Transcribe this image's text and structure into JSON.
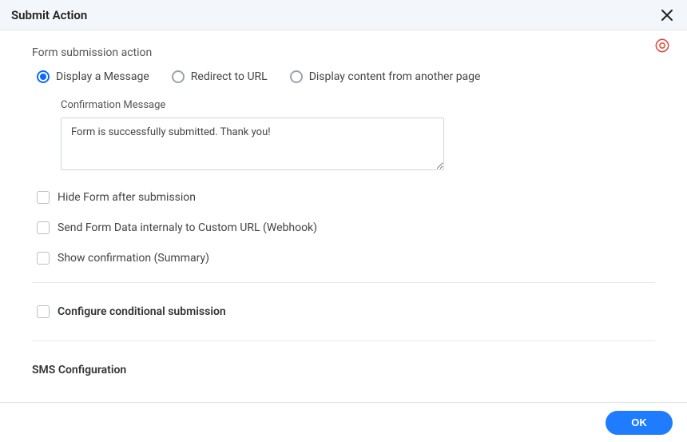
{
  "header": {
    "title": "Submit Action"
  },
  "section": {
    "title": "Form submission action",
    "radios": {
      "displayMessage": "Display a Message",
      "redirect": "Redirect to URL",
      "displayContent": "Display content from another page"
    },
    "confirmation": {
      "label": "Confirmation Message",
      "value": "Form is successfully submitted. Thank you!"
    },
    "checkboxes": {
      "hideForm": "Hide Form after submission",
      "webhook": "Send Form Data internaly to Custom URL (Webhook)",
      "summary": "Show confirmation (Summary)",
      "conditional": "Configure conditional submission"
    }
  },
  "truncated": {
    "sms": "SMS Configuration"
  },
  "footer": {
    "ok": "OK"
  }
}
